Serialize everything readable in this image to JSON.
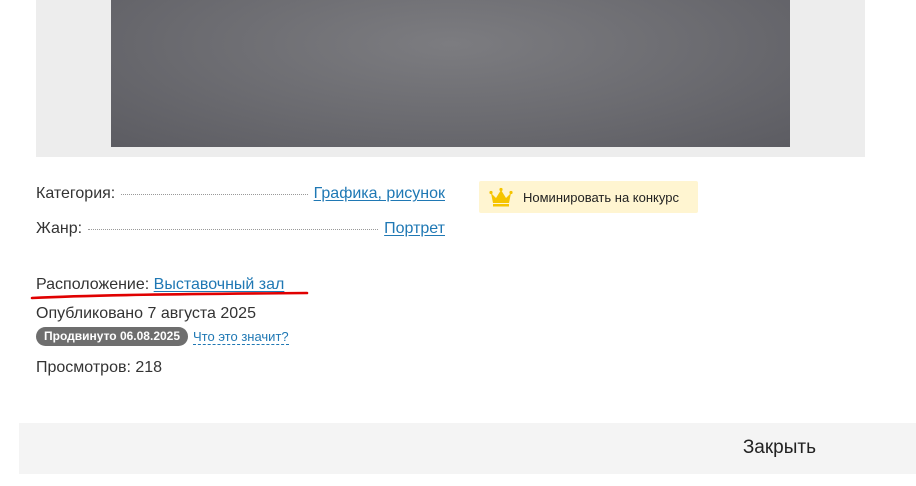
{
  "details": {
    "category_label": "Категория:",
    "category_value": "Графика, рисунок",
    "genre_label": "Жанр:",
    "genre_value": "Портрет",
    "location_label": "Расположение:",
    "location_value": "Выставочный зал",
    "published": "Опубликовано 7 августа 2025",
    "promoted_badge": "Продвинуто 06.08.2025",
    "promoted_help_link": "Что это значит?",
    "views": "Просмотров: 218"
  },
  "nominate": {
    "label": "Номинировать на конкурс",
    "icon": "crown-icon"
  },
  "footer": {
    "close_label": "Закрыть"
  },
  "colors": {
    "link": "#1f78b4",
    "nominate_bg": "#fff5d1",
    "crown": "#f5c400",
    "annotation_underline": "#e00000",
    "badge_bg": "#6e6e6e"
  }
}
